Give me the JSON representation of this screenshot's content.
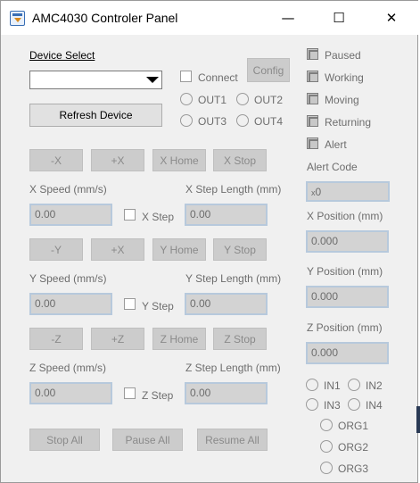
{
  "window": {
    "title": "AMC4030 Controler Panel",
    "minimize_glyph": "—",
    "maximize_glyph": "☐",
    "close_glyph": "✕"
  },
  "device": {
    "select_label": "Device Select",
    "select_value": "",
    "connect_label": "Connect",
    "config_label": "Config",
    "refresh_label": "Refresh Device"
  },
  "outputs": [
    "OUT1",
    "OUT2",
    "OUT3",
    "OUT4"
  ],
  "status": {
    "paused": "Paused",
    "working": "Working",
    "moving": "Moving",
    "returning": "Returning",
    "alert": "Alert",
    "alert_code_label": "Alert Code",
    "alert_code_value": "0",
    "alert_code_prefix": "x",
    "x_position_label": "X Position (mm)",
    "x_position_value": "0.000",
    "y_position_label": "Y Position (mm)",
    "y_position_value": "0.000",
    "z_position_label": "Z Position (mm)",
    "z_position_value": "0.000"
  },
  "inputs": [
    "IN1",
    "IN2",
    "IN3",
    "IN4"
  ],
  "origins": [
    "ORG1",
    "ORG2",
    "ORG3"
  ],
  "x_axis": {
    "minus": "-X",
    "plus": "+X",
    "home": "X Home",
    "stop": "X Stop",
    "speed_label": "X Speed (mm/s)",
    "speed_value": "0.00",
    "step_label": "X Step",
    "step_length_label": "X Step Length (mm)",
    "step_length_value": "0.00"
  },
  "y_axis": {
    "minus": "-Y",
    "plus": "+X",
    "home": "Y Home",
    "stop": "Y Stop",
    "speed_label": "Y Speed (mm/s)",
    "speed_value": "0.00",
    "step_label": "Y Step",
    "step_length_label": "Y Step Length (mm)",
    "step_length_value": "0.00"
  },
  "z_axis": {
    "minus": "-Z",
    "plus": "+Z",
    "home": "Z Home",
    "stop": "Z Stop",
    "speed_label": "Z Speed (mm/s)",
    "speed_value": "0.00",
    "step_label": "Z Step",
    "step_length_label": "Z Step Length (mm)",
    "step_length_value": "0.00"
  },
  "actions": {
    "stop_all": "Stop All",
    "pause_all": "Pause All",
    "resume_all": "Resume All"
  }
}
